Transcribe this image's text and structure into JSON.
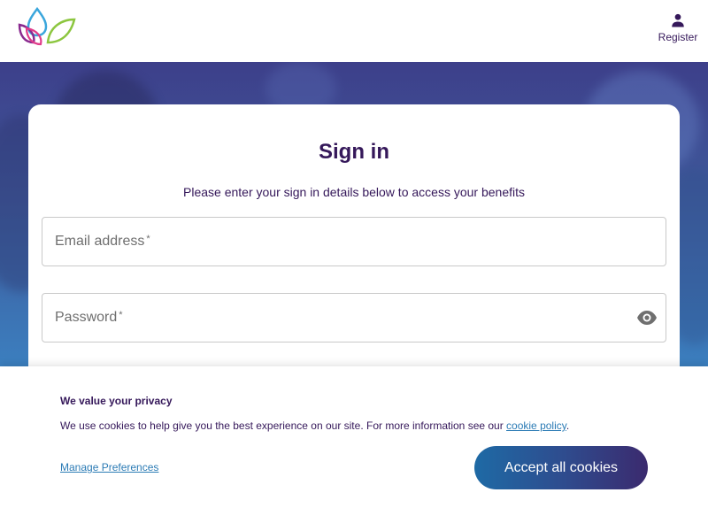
{
  "header": {
    "logo_icon": "droplet-leaves-logo-icon",
    "register_icon": "person-icon",
    "register_label": "Register"
  },
  "signin": {
    "title": "Sign in",
    "subtitle": "Please enter your sign in details below to access your benefits",
    "email_label": "Email address",
    "email_required": "*",
    "password_label": "Password",
    "password_required": "*",
    "toggle_icon": "eye-icon"
  },
  "cookie": {
    "title": "We value your privacy",
    "text_before_link": "We use cookies to help give you the best experience on our site. For more information see our ",
    "link_label": "cookie policy",
    "text_after_link": ".",
    "manage_label": "Manage Preferences",
    "accept_label": "Accept all cookies"
  },
  "colors": {
    "brand_purple": "#35185a",
    "link_blue": "#2b7bb5",
    "button_gradient_start": "#1e6aa5",
    "button_gradient_end": "#3b2a6e"
  }
}
